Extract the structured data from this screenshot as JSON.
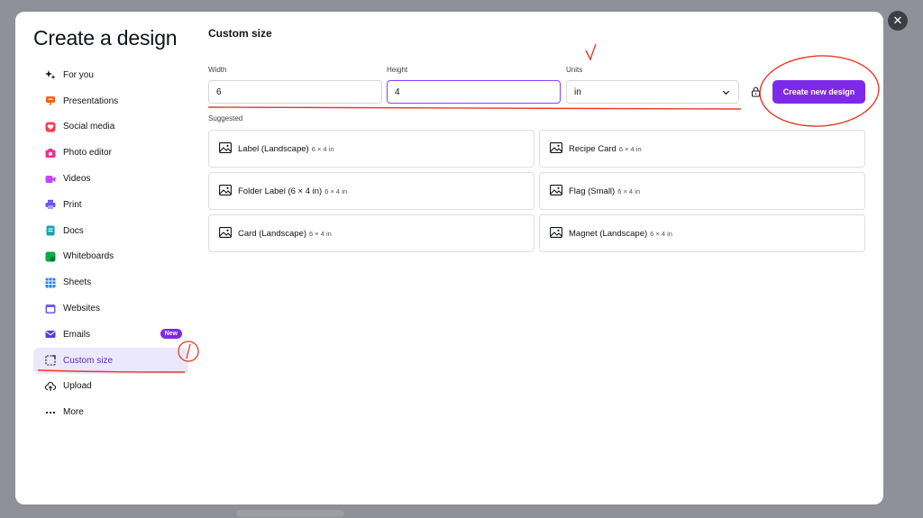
{
  "modal": {
    "title": "Create a design",
    "close_symbol": "✕"
  },
  "sidebar": {
    "items": [
      {
        "label": "For you",
        "icon": "sparkle-icon",
        "color": "#0e1318"
      },
      {
        "label": "Presentations",
        "icon": "presentation-icon",
        "color": "#ff6105"
      },
      {
        "label": "Social media",
        "icon": "heart-icon",
        "color": "#ff3b4b"
      },
      {
        "label": "Photo editor",
        "icon": "camera-icon",
        "color": "#f52f8c"
      },
      {
        "label": "Videos",
        "icon": "video-icon",
        "color": "#c645ff"
      },
      {
        "label": "Print",
        "icon": "printer-icon",
        "color": "#6453f7"
      },
      {
        "label": "Docs",
        "icon": "doc-icon",
        "color": "#13a3b5"
      },
      {
        "label": "Whiteboards",
        "icon": "whiteboard-icon",
        "color": "#0ba84a"
      },
      {
        "label": "Sheets",
        "icon": "sheet-icon",
        "color": "#2e7cf6"
      },
      {
        "label": "Websites",
        "icon": "website-icon",
        "color": "#6c5cf5"
      },
      {
        "label": "Emails",
        "icon": "email-icon",
        "color": "#4f3ee0",
        "badge": "New"
      },
      {
        "label": "Custom size",
        "icon": "custom-size-icon",
        "color": "#0e1318",
        "active": true
      },
      {
        "label": "Upload",
        "icon": "upload-cloud-icon",
        "color": "#0e1318"
      },
      {
        "label": "More",
        "icon": "more-dots-icon",
        "color": "#0e1318"
      }
    ]
  },
  "main": {
    "title": "Custom size",
    "width_label": "Width",
    "width_value": "6",
    "height_label": "Height",
    "height_value": "4",
    "units_label": "Units",
    "units_value": "in",
    "create_button": "Create new design",
    "suggested_label": "Suggested",
    "suggestions": [
      {
        "name": "Label (Landscape)",
        "dims": "6 × 4 in"
      },
      {
        "name": "Recipe Card",
        "dims": "6 × 4 in"
      },
      {
        "name": "Folder Label (6 × 4 in)",
        "dims": "6 × 4 in"
      },
      {
        "name": "Flag (Small)",
        "dims": "6 × 4 in"
      },
      {
        "name": "Card (Landscape)",
        "dims": "6 × 4 in"
      },
      {
        "name": "Magnet (Landscape)",
        "dims": "6 × 4 in"
      }
    ]
  },
  "colors": {
    "accent": "#7d2ae8",
    "active_bg": "#ece8fb",
    "annotation": "#e8392c"
  }
}
